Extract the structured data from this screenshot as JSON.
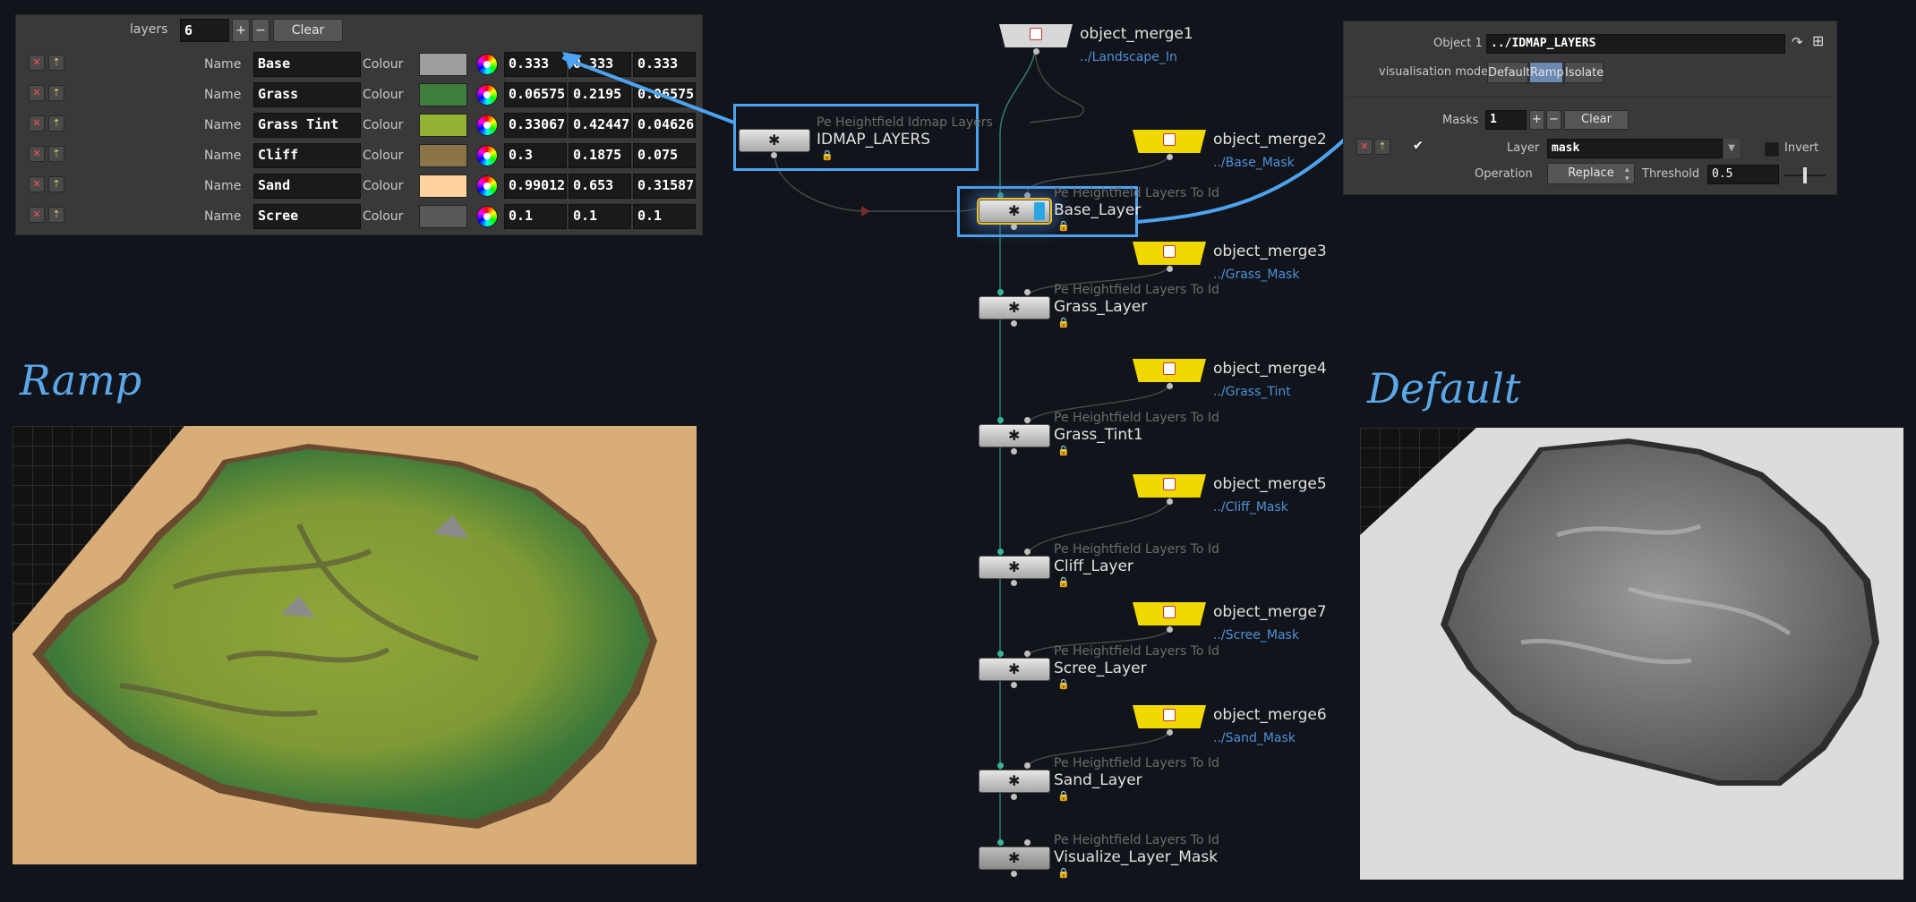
{
  "layer_params": {
    "count_label": "layers",
    "count_value": "6",
    "clear_label": "Clear",
    "plus": "+",
    "minus": "−",
    "name_label": "Name",
    "colour_label": "Colour",
    "rows": [
      {
        "name": "Base",
        "swatch": "#9e9e9e",
        "r": "0.333",
        "g": "0.333",
        "b": "0.333"
      },
      {
        "name": "Grass",
        "swatch": "#3f7e3c",
        "r": "0.06575",
        "g": "0.2195",
        "b": "0.06575"
      },
      {
        "name": "Grass Tint",
        "swatch": "#93b232",
        "r": "0.33067",
        "g": "0.42447",
        "b": "0.04626"
      },
      {
        "name": "Cliff",
        "swatch": "#8b7447",
        "r": "0.3",
        "g": "0.1875",
        "b": "0.075"
      },
      {
        "name": "Sand",
        "swatch": "#ffd39e",
        "r": "0.99012",
        "g": "0.653",
        "b": "0.31587"
      },
      {
        "name": "Scree",
        "swatch": "#585858",
        "r": "0.1",
        "g": "0.1",
        "b": "0.1"
      }
    ]
  },
  "headings": {
    "ramp": "Ramp",
    "default": "Default"
  },
  "nodes": {
    "idmap": {
      "type": "Pe Heightfield Idmap Layers",
      "name": "IDMAP_LAYERS"
    },
    "merges": [
      {
        "name": "object_merge1",
        "path": "../Landscape_In"
      },
      {
        "name": "object_merge2",
        "path": "../Base_Mask"
      },
      {
        "name": "object_merge3",
        "path": "../Grass_Mask"
      },
      {
        "name": "object_merge4",
        "path": "../Grass_Tint"
      },
      {
        "name": "object_merge5",
        "path": "../Cliff_Mask"
      },
      {
        "name": "object_merge7",
        "path": "../Scree_Mask"
      },
      {
        "name": "object_merge6",
        "path": "../Sand_Mask"
      }
    ],
    "layers": [
      {
        "type": "Pe Heightfield Layers To Id",
        "name": "Base_Layer"
      },
      {
        "type": "Pe Heightfield Layers To Id",
        "name": "Grass_Layer"
      },
      {
        "type": "Pe Heightfield Layers To Id",
        "name": "Grass_Tint1"
      },
      {
        "type": "Pe Heightfield Layers To Id",
        "name": "Cliff_Layer"
      },
      {
        "type": "Pe Heightfield Layers To Id",
        "name": "Scree_Layer"
      },
      {
        "type": "Pe Heightfield Layers To Id",
        "name": "Sand_Layer"
      },
      {
        "type": "Pe Heightfield Layers To Id",
        "name": "Visualize_Layer_Mask"
      }
    ]
  },
  "mask_params": {
    "object_label": "Object 1",
    "object_value": "../IDMAP_LAYERS",
    "vis_label": "visualisation mode",
    "vis_options": [
      "Default",
      "Ramp",
      "Isolate"
    ],
    "vis_selected": "Ramp",
    "masks_label": "Masks",
    "masks_value": "1",
    "clear_label": "Clear",
    "layer_label": "Layer",
    "layer_value": "mask",
    "invert_label": "Invert",
    "operation_label": "Operation",
    "operation_value": "Replace",
    "threshold_label": "Threshold",
    "threshold_value": "0.5",
    "threshold_level": 0.5
  },
  "colors": {
    "accent": "#4ea3f0",
    "merge_node": "#f0d800",
    "wire": "#3a9b82"
  }
}
